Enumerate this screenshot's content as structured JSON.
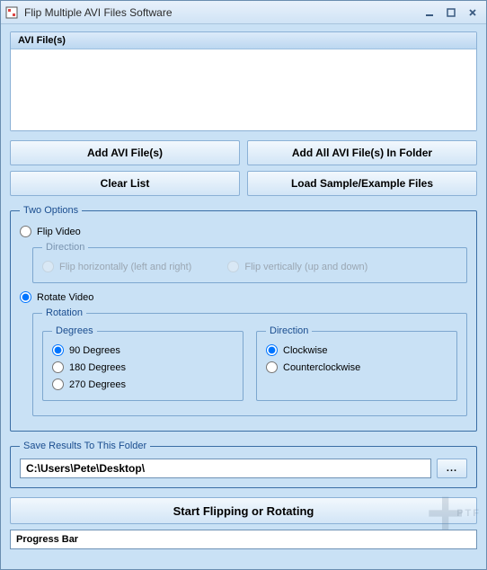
{
  "window": {
    "title": "Flip Multiple AVI Files Software"
  },
  "filelist": {
    "header": "AVI File(s)"
  },
  "buttons": {
    "add": "Add AVI File(s)",
    "add_folder": "Add All AVI File(s) In Folder",
    "clear": "Clear List",
    "load_sample": "Load Sample/Example Files",
    "browse": "...",
    "start": "Start Flipping or Rotating"
  },
  "options": {
    "legend": "Two Options",
    "flip": {
      "label": "Flip Video",
      "selected": false,
      "direction_legend": "Direction",
      "horiz": "Flip horizontally (left and right)",
      "vert": "Flip vertically (up and down)"
    },
    "rotate": {
      "label": "Rotate Video",
      "selected": true,
      "rotation_legend": "Rotation",
      "degrees_legend": "Degrees",
      "d90": "90 Degrees",
      "d180": "180 Degrees",
      "d270": "270 Degrees",
      "direction_legend": "Direction",
      "cw": "Clockwise",
      "ccw": "Counterclockwise"
    }
  },
  "save": {
    "legend": "Save Results To This Folder",
    "path": "C:\\Users\\Pete\\Desktop\\"
  },
  "progress": {
    "label": "Progress Bar"
  },
  "watermark": "PTF"
}
